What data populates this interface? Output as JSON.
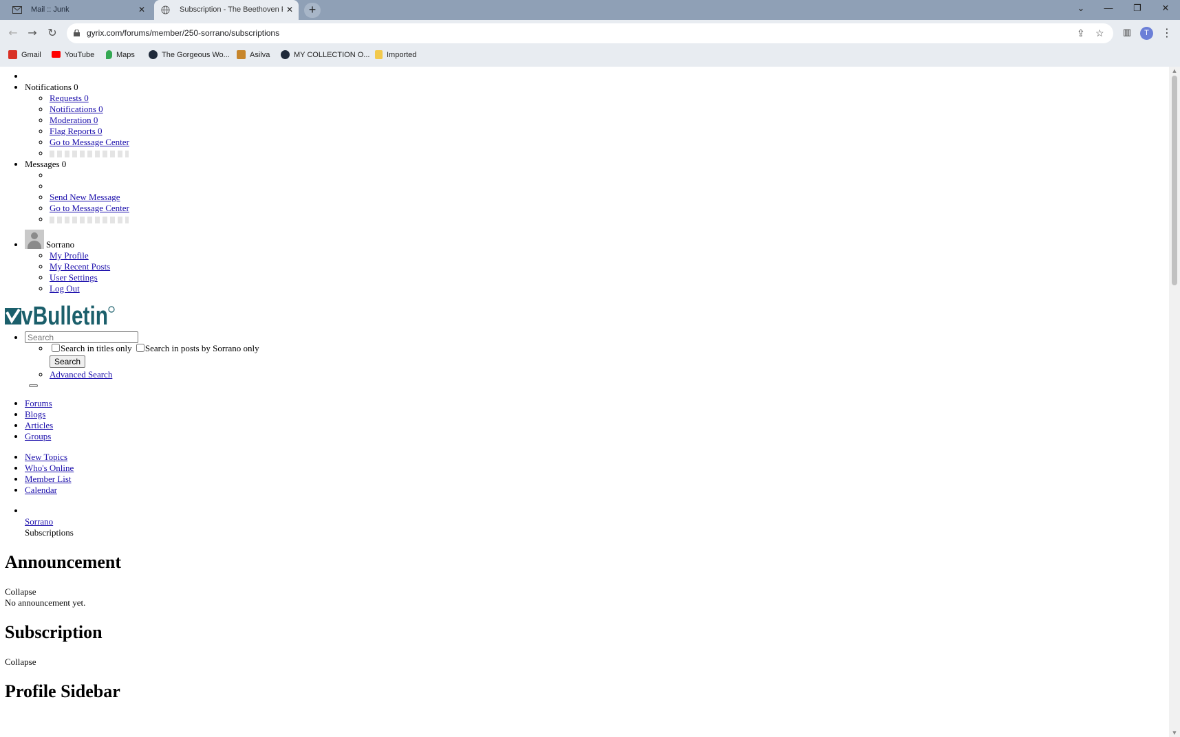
{
  "browser": {
    "tabs": [
      {
        "label": "Mail :: Junk",
        "icon": "mail-icon"
      },
      {
        "label": "Subscription - The Beethoven Re",
        "icon": "globe-icon",
        "active": true
      }
    ],
    "new_tab": "+",
    "window_controls": {
      "menu": "⌄",
      "minimize": "—",
      "restore": "❐",
      "close": "✕"
    },
    "url": "gyrix.com/forums/member/250-sorrano/subscriptions",
    "profile_initial": "T",
    "bookmarks": [
      {
        "label": "Gmail",
        "icon": "gmail-icon",
        "color": "#d93025"
      },
      {
        "label": "YouTube",
        "icon": "youtube-icon",
        "color": "#ff0000"
      },
      {
        "label": "Maps",
        "icon": "maps-icon",
        "color": "#34a853"
      },
      {
        "label": "The Gorgeous Wo...",
        "icon": "tumblr-icon",
        "color": "#1f2a3a"
      },
      {
        "label": "Asilva",
        "icon": "asilva-icon",
        "color": "#c7862c"
      },
      {
        "label": "MY COLLECTION O...",
        "icon": "tumblr-icon",
        "color": "#1f2a3a"
      },
      {
        "label": "Imported",
        "icon": "folder-icon",
        "color": "#f2c94c"
      }
    ]
  },
  "page": {
    "notifications": {
      "label": "Notifications 0",
      "items": [
        "Requests 0",
        "Notifications 0",
        "Moderation 0",
        "Flag Reports 0",
        "Go to Message Center"
      ]
    },
    "messages": {
      "label": "Messages 0",
      "items": [
        "Send New Message",
        "Go to Message Center"
      ]
    },
    "user": {
      "name": "Sorrano",
      "items": [
        "My Profile",
        "My Recent Posts",
        "User Settings",
        "Log Out"
      ]
    },
    "logo_text": "vBulletin",
    "search": {
      "placeholder": "Search",
      "titles_only": "Search in titles only",
      "posts_by": "Search in posts by Sorrano only",
      "button": "Search",
      "advanced": "Advanced Search"
    },
    "main_nav": [
      "Forums",
      "Blogs",
      "Articles",
      "Groups"
    ],
    "sub_nav": [
      "New Topics",
      "Who's Online",
      "Member List",
      "Calendar"
    ],
    "breadcrumb": {
      "link": "Sorrano",
      "current": "Subscriptions"
    },
    "announcement": {
      "heading": "Announcement",
      "collapse": "Collapse",
      "text": "No announcement yet."
    },
    "subscription": {
      "heading": "Subscription",
      "collapse": "Collapse"
    },
    "profile_sidebar": {
      "heading": "Profile Sidebar"
    }
  }
}
